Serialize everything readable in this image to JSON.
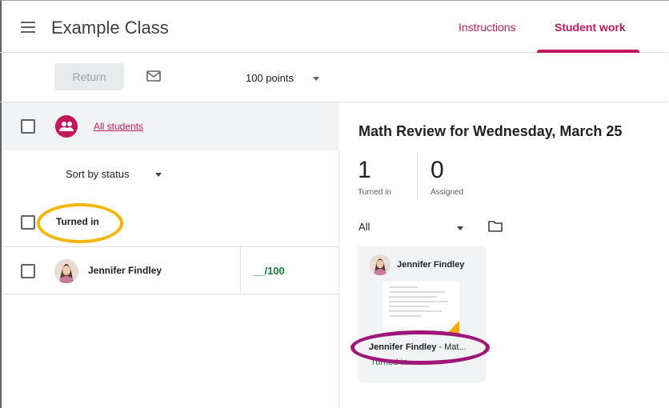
{
  "header": {
    "title": "Example Class",
    "tabs": [
      {
        "label": "Instructions",
        "active": false
      },
      {
        "label": "Student work",
        "active": true
      }
    ]
  },
  "toolbar": {
    "return_label": "Return",
    "points_value": "100 points"
  },
  "roster": {
    "all_students_label": "All students",
    "sort_label": "Sort by status",
    "group_header": "Turned in",
    "students": [
      {
        "name": "Jennifer Findley",
        "grade": "__/100"
      }
    ]
  },
  "assignment": {
    "title": "Math Review for Wednesday, March 25",
    "stats": [
      {
        "value": "1",
        "label": "Turned in"
      },
      {
        "value": "0",
        "label": "Assigned"
      }
    ],
    "filter_value": "All",
    "card": {
      "student_name": "Jennifer Findley",
      "file_name": "Jennifer Findley",
      "file_suffix": " - Mat...",
      "status": "Turned in"
    }
  },
  "colors": {
    "accent": "#c2185b",
    "success": "#188038",
    "highlight_yellow": "#f4b400",
    "highlight_purple": "#a0157a"
  },
  "icons": [
    "menu-icon",
    "mail-icon",
    "group-icon",
    "folder-icon",
    "dropdown-caret-icon"
  ]
}
